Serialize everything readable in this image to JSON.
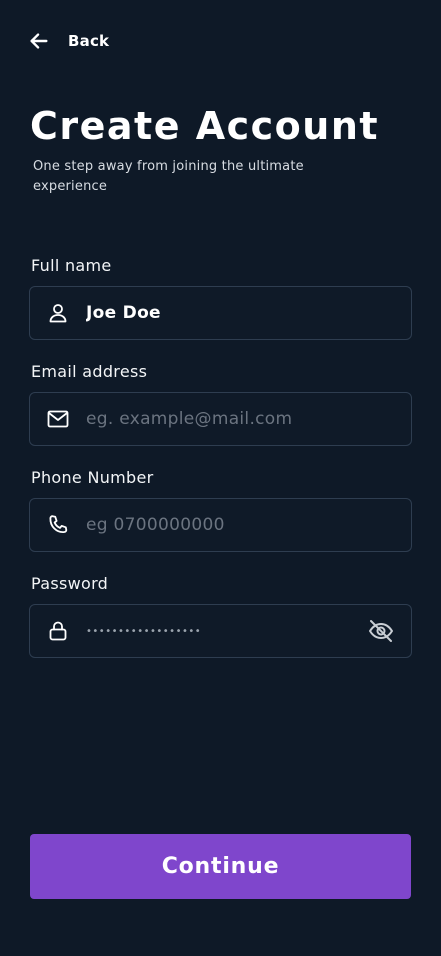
{
  "header": {
    "back_label": "Back",
    "back_icon": "arrow-left-icon"
  },
  "page": {
    "title": "Create Account",
    "subtitle": "One step away from joining the ultimate experience"
  },
  "form": {
    "full_name": {
      "label": "Full name",
      "value": "Joe Doe",
      "placeholder": "",
      "icon": "user-icon"
    },
    "email": {
      "label": "Email address",
      "value": "",
      "placeholder": "eg. example@mail.com",
      "icon": "mail-icon"
    },
    "phone": {
      "label": "Phone Number",
      "value": "",
      "placeholder": "eg 0700000000",
      "icon": "phone-icon"
    },
    "password": {
      "label": "Password",
      "value": "••••••••••••••••••",
      "icon": "lock-icon",
      "toggle_icon": "eye-off-icon"
    }
  },
  "actions": {
    "continue_label": "Continue"
  },
  "colors": {
    "background": "#0e1927",
    "field_border": "#2e3d50",
    "accent": "#7f46cc",
    "placeholder": "#6b7480"
  }
}
